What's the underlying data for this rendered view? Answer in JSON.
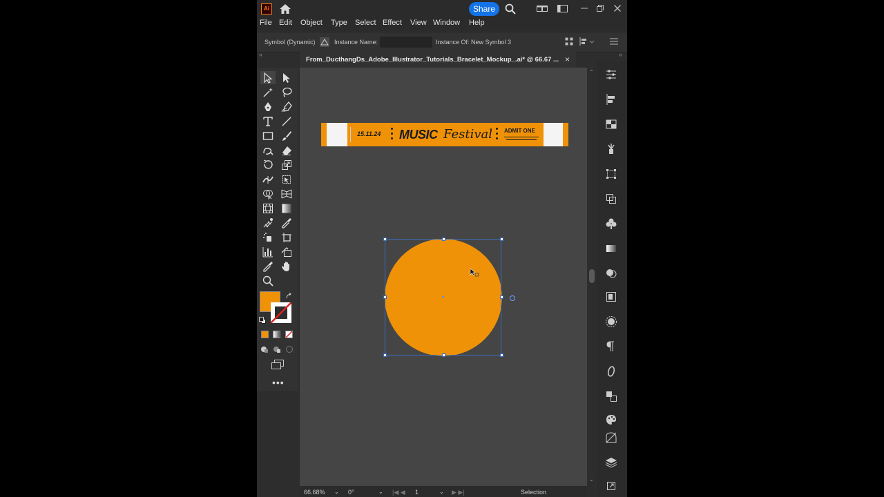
{
  "appbar": {
    "logo": "Ai",
    "share_label": "Share"
  },
  "menu": [
    "File",
    "Edit",
    "Object",
    "Type",
    "Select",
    "Effect",
    "View",
    "Window",
    "Help"
  ],
  "control_bar": {
    "symbol_label": "Symbol (Dynamic)",
    "instance_name_label": "Instance Name:",
    "instance_name_value": "",
    "instance_of": "Instance Of: New Symbol 3"
  },
  "document": {
    "tab_title": "From_DucthangDs_Adobe_Illustrator_Tutorials_Bracelet_Mockup_.ai* @ 66.67 ...",
    "close": "×"
  },
  "artwork": {
    "bracelet": {
      "date": "15.11.24",
      "title_bold": "MUSIC",
      "title_script": "Festival",
      "admit": "ADMIT ONE"
    },
    "circle_color": "#EF9208"
  },
  "colors": {
    "fill": "#EF9208",
    "stroke": "#FFFFFF",
    "accent": "#1473E6"
  },
  "status": {
    "zoom": "66.68%",
    "rotation": "0°",
    "artboard": "1",
    "tool": "Selection"
  },
  "toolbar_more": "•••"
}
